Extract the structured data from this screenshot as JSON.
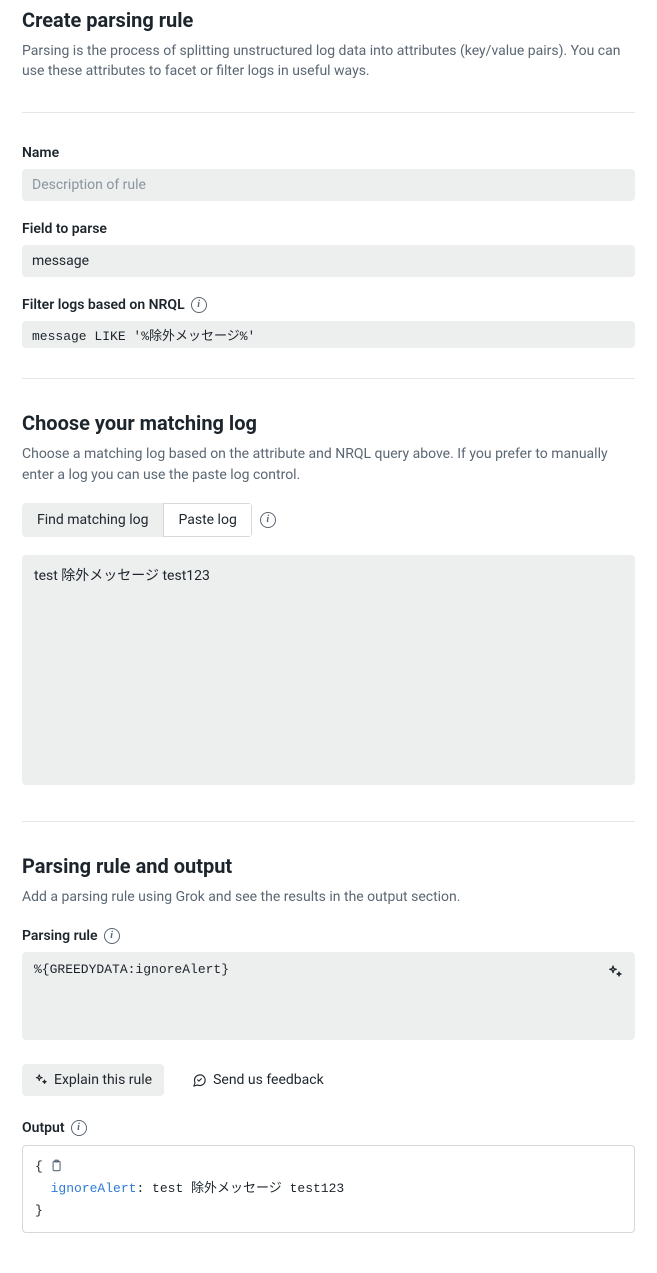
{
  "create": {
    "title": "Create parsing rule",
    "desc": "Parsing is the process of splitting unstructured log data into attributes (key/value pairs). You can use these attributes to facet or filter logs in useful ways.",
    "name_label": "Name",
    "name_placeholder": "Description of rule",
    "name_value": "",
    "field_label": "Field to parse",
    "field_value": "message",
    "filter_label": "Filter logs based on NRQL",
    "filter_value": "message LIKE '%除外メッセージ%'"
  },
  "matching": {
    "title": "Choose your matching log",
    "desc": "Choose a matching log based on the attribute and NRQL query above. If you prefer to manually enter a log you can use the paste log control.",
    "find_label": "Find matching log",
    "paste_label": "Paste log",
    "log_value": "test 除外メッセージ test123"
  },
  "parsing": {
    "title": "Parsing rule and output",
    "desc": "Add a parsing rule using Grok and see the results in the output section.",
    "rule_label": "Parsing rule",
    "rule_value": "%{GREEDYDATA:ignoreAlert}",
    "explain_label": "Explain this rule",
    "feedback_label": "Send us feedback",
    "output_label": "Output",
    "output_key": "ignoreAlert",
    "output_val": "test 除外メッセージ test123"
  }
}
